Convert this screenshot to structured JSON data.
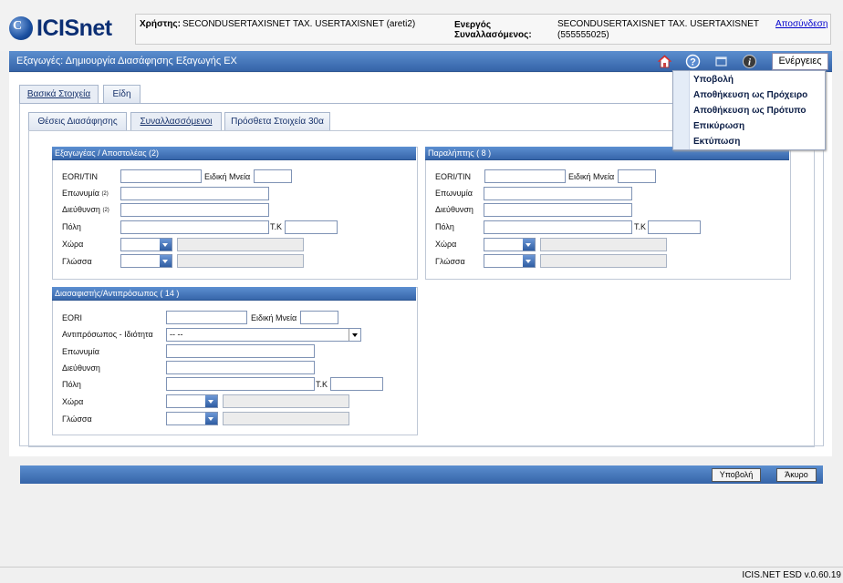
{
  "app": {
    "logo_text": "ICISnet",
    "version": "ICIS.NET ESD v.0.60.19"
  },
  "header": {
    "user_label": "Χρήστης:",
    "user_value": "SECONDUSERTAXISNET TAX. USERTAXISNET (areti2)",
    "active_label_1": "Ενεργός",
    "active_label_2": "Συναλλασόμενος:",
    "active_value_1": "SECONDUSERTAXISNET TAX. USERTAXISNET",
    "active_value_2": "(555555025)",
    "logout": "Αποσύνδεση"
  },
  "titlebar": {
    "title": "Εξαγωγές: Δημιουργία Διασάφησης Εξαγωγής ΕΧ",
    "icons": [
      "home-icon",
      "help-icon",
      "window-icon",
      "info-icon"
    ],
    "actions_label": "Ενέργειες"
  },
  "menu": {
    "items": [
      "Υποβολή",
      "Αποθήκευση ως Πρόχειρο",
      "Αποθήκευση ως Πρότυπο",
      "Επικύρωση",
      "Εκτύπωση"
    ]
  },
  "tabs": {
    "top": [
      "Βασικά Στοιχεία",
      "Είδη"
    ],
    "sub": [
      "Θέσεις Διασάφησης",
      "Συναλλασσόμενοι",
      "Πρόσθετα Στοιχεία 30α"
    ]
  },
  "exporter": {
    "title": "Εξαγωγέας / Αποστολέας (2)",
    "eori_label": "EORI/TIN",
    "special_label": "Ειδική Μνεία",
    "name_label": "Επωνυμία",
    "name_sup": "(2)",
    "address_label": "Διεύθυνση",
    "address_sup": "(2)",
    "city_label": "Πόλη",
    "zip_label": "Τ.Κ",
    "country_label": "Χώρα",
    "language_label": "Γλώσσα"
  },
  "consignee": {
    "title": "Παραλήπτης ( 8 )",
    "eori_label": "EORI/TIN",
    "special_label": "Ειδική Μνεία",
    "name_label": "Επωνυμία",
    "address_label": "Διεύθυνση",
    "city_label": "Πόλη",
    "zip_label": "Τ.Κ",
    "country_label": "Χώρα",
    "language_label": "Γλώσσα"
  },
  "declarant": {
    "title": "Διασαφιστής/Αντιπρόσωπος ( 14 )",
    "eori_label": "EORI",
    "special_label": "Ειδική Μνεία",
    "rep_label": "Αντιπρόσωπος - Ιδιότητα",
    "rep_value": "-- --",
    "name_label": "Επωνυμία",
    "address_label": "Διεύθυνση",
    "city_label": "Πόλη",
    "zip_label": "Τ.Κ",
    "country_label": "Χώρα",
    "language_label": "Γλώσσα"
  },
  "footer_buttons": {
    "submit": "Υποβολή",
    "cancel": "Άκυρο"
  },
  "colors": {
    "accent": "#3f6fb5",
    "logo": "#0c2f74"
  }
}
